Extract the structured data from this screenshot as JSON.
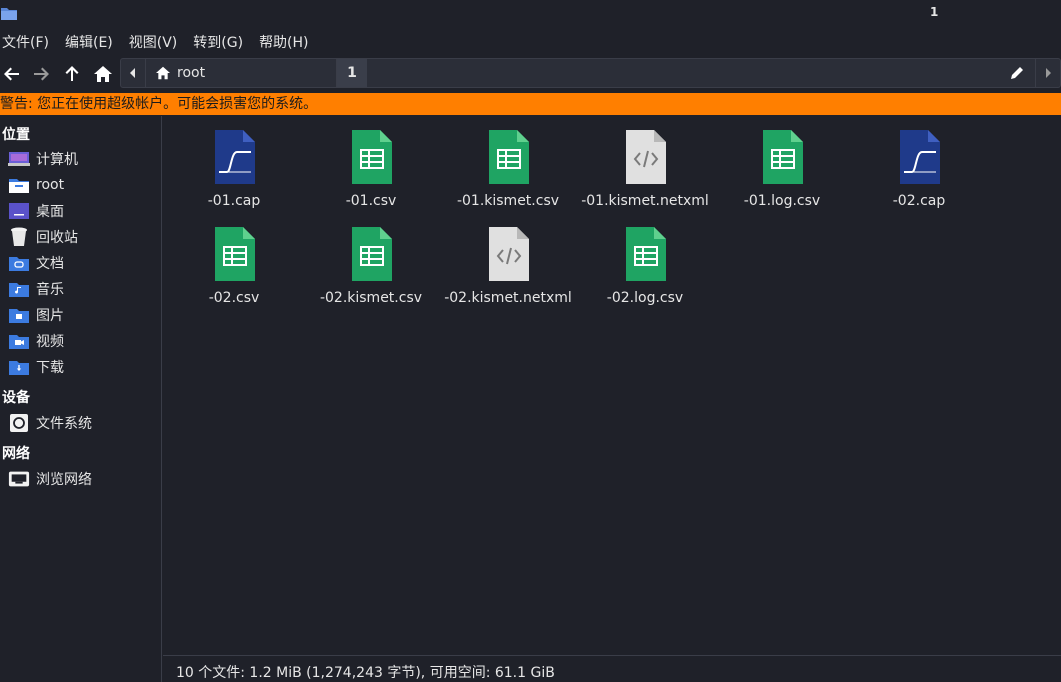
{
  "window": {
    "title": "1"
  },
  "menu": [
    "文件(F)",
    "编辑(E)",
    "视图(V)",
    "转到(G)",
    "帮助(H)"
  ],
  "pathbar": {
    "root_label": "root",
    "current": "1"
  },
  "warning": "警告: 您正在使用超级帐户。可能会损害您的系统。",
  "sidebar": {
    "places_heading": "位置",
    "places": [
      {
        "label": "计算机",
        "icon": "computer-icon"
      },
      {
        "label": "root",
        "icon": "home-folder-icon"
      },
      {
        "label": "桌面",
        "icon": "desktop-icon"
      },
      {
        "label": "回收站",
        "icon": "trash-icon"
      },
      {
        "label": "文档",
        "icon": "documents-folder-icon"
      },
      {
        "label": "音乐",
        "icon": "music-folder-icon"
      },
      {
        "label": "图片",
        "icon": "pictures-folder-icon"
      },
      {
        "label": "视频",
        "icon": "videos-folder-icon"
      },
      {
        "label": "下载",
        "icon": "downloads-folder-icon"
      }
    ],
    "devices_heading": "设备",
    "devices": [
      {
        "label": "文件系统",
        "icon": "drive-icon"
      }
    ],
    "network_heading": "网络",
    "network": [
      {
        "label": "浏览网络",
        "icon": "network-icon"
      }
    ]
  },
  "files": [
    {
      "name": "-01.cap",
      "type": "capture"
    },
    {
      "name": "-01.csv",
      "type": "spreadsheet"
    },
    {
      "name": "-01.kismet.csv",
      "type": "spreadsheet"
    },
    {
      "name": "-01.kismet.netxml",
      "type": "xml"
    },
    {
      "name": "-01.log.csv",
      "type": "spreadsheet"
    },
    {
      "name": "-02.cap",
      "type": "capture"
    },
    {
      "name": "-02.csv",
      "type": "spreadsheet"
    },
    {
      "name": "-02.kismet.csv",
      "type": "spreadsheet"
    },
    {
      "name": "-02.kismet.netxml",
      "type": "xml"
    },
    {
      "name": "-02.log.csv",
      "type": "spreadsheet"
    }
  ],
  "status": "10 个文件: 1.2 MiB (1,274,243 字节), 可用空间: 61.1 GiB",
  "colors": {
    "warning_bg": "#ff7f00",
    "spreadsheet": "#1fa463",
    "capture": "#1f3a8a",
    "xml": "#e0e0e0",
    "folder": "#3c7be0"
  }
}
